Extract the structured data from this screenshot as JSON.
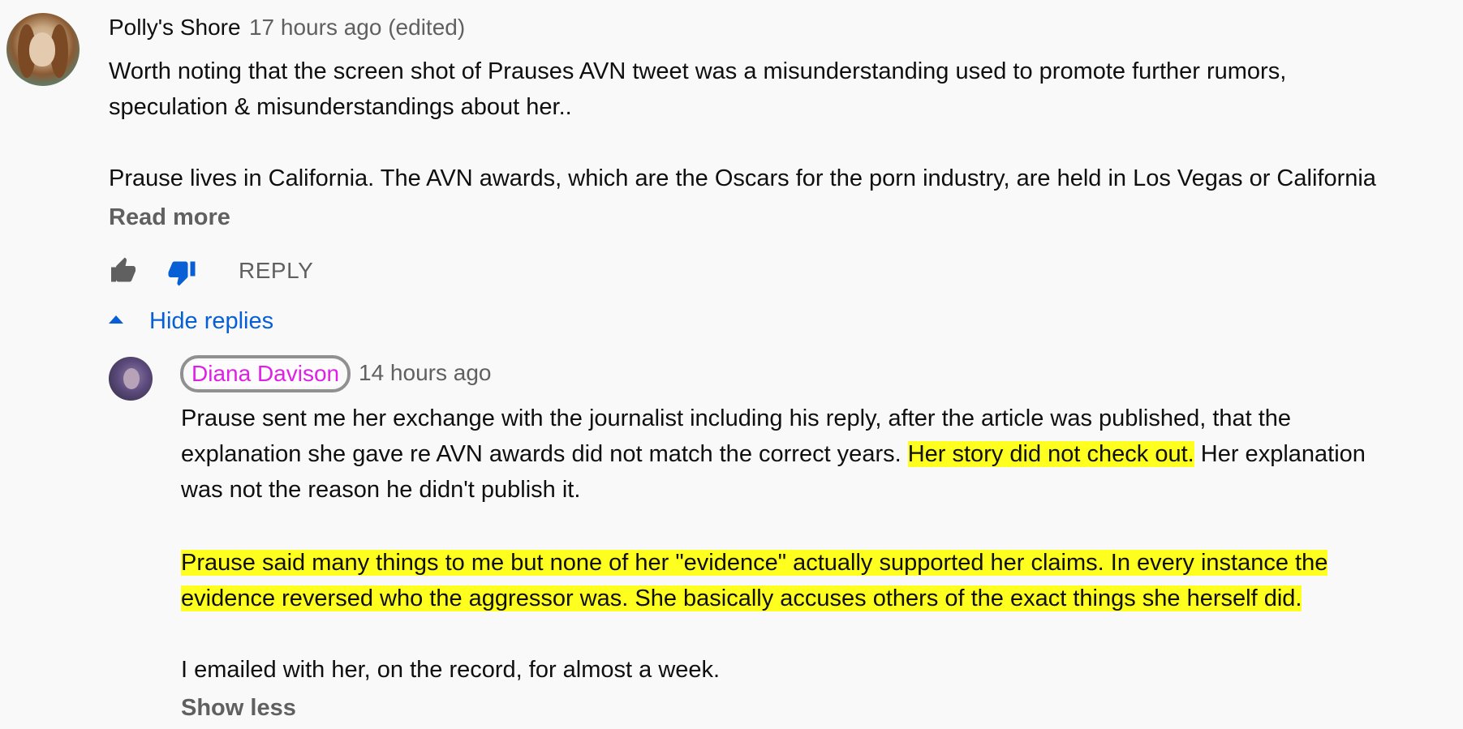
{
  "comment": {
    "author": "Polly's Shore",
    "timestamp": "17 hours ago (edited)",
    "lines": [
      "Worth noting that the screen shot of Prauses AVN tweet was a misunderstanding used to promote further rumors,",
      "speculation & misunderstandings about her..",
      "Prause lives in California. The AVN awards, which are the Oscars for the porn industry, are held in Los Vegas or California"
    ],
    "read_more_label": "Read more",
    "reply_label": "REPLY",
    "like_icon": "thumbs-up-icon",
    "dislike_icon": "thumbs-down-icon",
    "dislike_color": "#065fd4",
    "hide_replies_label": "Hide replies"
  },
  "reply": {
    "author": "Diana Davison",
    "author_color": "#e01ee8",
    "timestamp": "14 hours ago",
    "p1_line1": "Prause sent me her exchange with the journalist including his reply, after the article was published, that the",
    "p1_line2_plain": "explanation she gave re AVN awards did not match the correct years. ",
    "p1_line2_highlight": "Her story did not check out.",
    "p1_line2_tail": " Her explanation",
    "p1_line3": "was not the reason he didn't publish it.",
    "p2_line1": "Prause said many things to me but none of her \"evidence\" actually supported her claims. In every instance the",
    "p2_line2": "evidence reversed who the aggressor was. She basically accuses others of the exact things she herself did.",
    "p3_line1": "I emailed with her, on the record, for almost a week.",
    "show_less_label": "Show less",
    "highlight_color": "#ffff1f"
  }
}
